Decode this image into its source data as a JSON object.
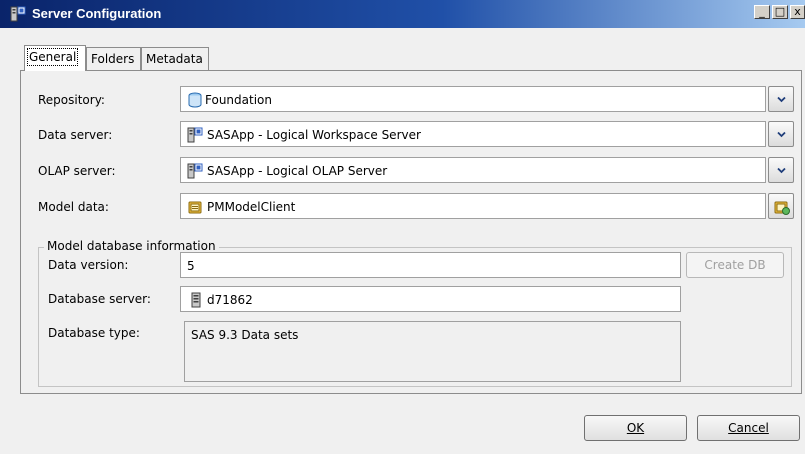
{
  "window": {
    "title": "Server Configuration",
    "minimize_glyph": "_",
    "maximize_glyph": "□",
    "close_glyph": "x"
  },
  "tabs": [
    {
      "label": "General",
      "active": true
    },
    {
      "label": "Folders",
      "active": false
    },
    {
      "label": "Metadata",
      "active": false
    }
  ],
  "fields": {
    "repository": {
      "label": "Repository:",
      "value": "Foundation",
      "icon": "database-icon"
    },
    "data_server": {
      "label": "Data server:",
      "value": "SASApp - Logical Workspace Server",
      "icon": "server-icon"
    },
    "olap_server": {
      "label": "OLAP server:",
      "value": "SASApp - Logical OLAP Server",
      "icon": "server-icon"
    },
    "model_data": {
      "label": "Model data:",
      "value": "PMModelClient",
      "icon": "model-icon"
    }
  },
  "model_db": {
    "legend": "Model database information",
    "data_version": {
      "label": "Data version:",
      "value": "5"
    },
    "database_server": {
      "label": "Database server:",
      "value": "d71862",
      "icon": "host-icon"
    },
    "database_type": {
      "label": "Database type:",
      "value": "SAS 9.3 Data sets"
    },
    "create_db_label": "Create DB"
  },
  "buttons": {
    "ok": "OK",
    "cancel": "Cancel"
  },
  "colors": {
    "titlebar_start": "#0a246a",
    "titlebar_end": "#a6caf0",
    "dialog_bg": "#f0f0f0"
  }
}
